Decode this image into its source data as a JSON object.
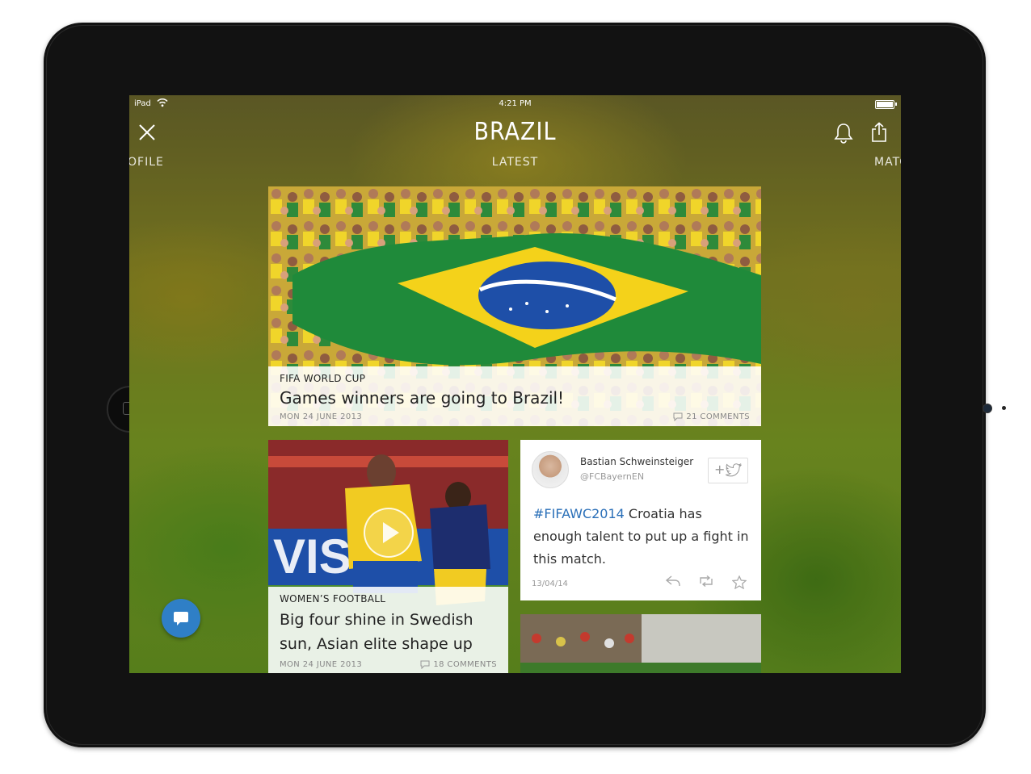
{
  "device": {
    "name": "iPad"
  },
  "status_bar": {
    "carrier": "iPad",
    "time": "4:21 PM",
    "battery_level": 1.0
  },
  "nav": {
    "title": "BRAZIL",
    "tabs": {
      "left": "OFILE",
      "center": "LATEST",
      "right": "MATC"
    },
    "icons": [
      "close-icon",
      "bell-icon",
      "share-icon"
    ]
  },
  "feed": {
    "headline": {
      "category": "FIFA WORLD CUP",
      "title": "Games winners are going to Brazil!",
      "date": "MON 24 JUNE 2013",
      "comments": "21 COMMENTS"
    },
    "video": {
      "category": "WOMEN’S FOOTBALL",
      "title": "Big four shine in Swedish sun, Asian elite shape up",
      "date": "MON 24 JUNE 2013",
      "comments": "18 COMMENTS"
    },
    "tweet": {
      "author": "Bastian Schweinsteiger",
      "handle": "@FCBayernEN",
      "follow_label": "+",
      "hashtag": "#FIFAWC2014",
      "text": " Croatia has enough talent to put up a fight in this match.",
      "date": "13/04/14"
    }
  },
  "colors": {
    "accent": "#2f7fc6",
    "hashtag": "#2a6fb8",
    "bezel": "#121212",
    "brazil_green": "#1f8a3a",
    "brazil_yellow": "#f4d21a",
    "brazil_blue": "#1e4fa8"
  }
}
